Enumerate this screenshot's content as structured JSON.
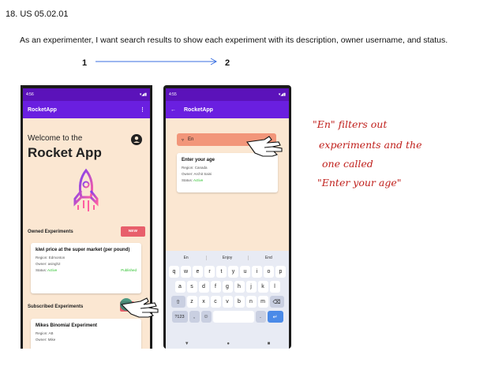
{
  "header": {
    "number": "18. US 05.02.01",
    "story": "As an experimenter, I want search results to show each experiment with its description, owner username, and status."
  },
  "flow": {
    "step_from": "1",
    "step_to": "2"
  },
  "screen1": {
    "status_time": "4:56",
    "app_name": "RocketApp",
    "welcome": "Welcome to the",
    "title": "Rocket App",
    "owned_label": "Owned Experiments",
    "new_button": "NEW",
    "owned_card": {
      "title": "kiwi price at the super market (per pound)",
      "region": "Region: Edmonton",
      "owner": "Owner: asingh2",
      "status_label": "Status:",
      "status_value": "Active",
      "published": "Published"
    },
    "subscribed_label": "Subscribed Experiments",
    "search_button": "SE",
    "subscribed_card": {
      "title": "Mikes Binomial Experiment",
      "region": "Region: AB",
      "owner": "Owner: Mike"
    }
  },
  "screen2": {
    "status_time": "4:55",
    "app_name": "RocketApp",
    "search_value": "En",
    "result_card": {
      "title": "Enter your age",
      "region": "Region: Canada",
      "owner": "Owner: Archit Saini",
      "status_label": "Status:",
      "status_value": "Active"
    },
    "keyboard": {
      "suggestions": [
        "En",
        "Enjoy",
        "End"
      ],
      "row1": [
        "q",
        "w",
        "e",
        "r",
        "t",
        "y",
        "u",
        "i",
        "o",
        "p"
      ],
      "row2": [
        "a",
        "s",
        "d",
        "f",
        "g",
        "h",
        "j",
        "k",
        "l"
      ],
      "row3": [
        "z",
        "x",
        "c",
        "v",
        "b",
        "n",
        "m"
      ],
      "symbols_key": "?123",
      "comma_key": ",",
      "period_key": "."
    }
  },
  "annotation": {
    "line1": "\"En\" filters out",
    "line2": "experiments and the",
    "line3": "one called",
    "line4": "\"Enter your age\""
  },
  "colors": {
    "status_bar": "#5b12ba",
    "app_bar": "#6a1fe0",
    "screen_bg": "#fbe7d2",
    "accent_pill": "#e85f6b",
    "search_bg": "#f2967a",
    "active_green": "#2ec22e",
    "annotation_red": "#c0201c"
  }
}
